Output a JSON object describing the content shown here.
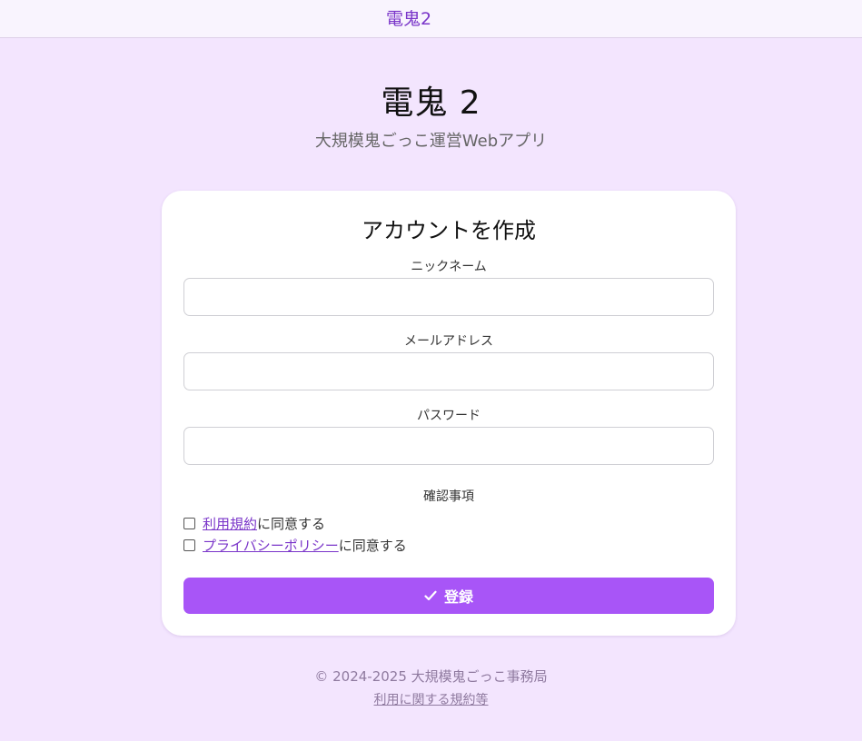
{
  "header": {
    "brand": "電鬼2"
  },
  "hero": {
    "title": "電鬼 2",
    "subtitle": "大規模鬼ごっこ運営Webアプリ"
  },
  "form": {
    "title": "アカウントを作成",
    "nickname_label": "ニックネーム",
    "nickname_value": "",
    "email_label": "メールアドレス",
    "email_value": "",
    "password_label": "パスワード",
    "password_value": "",
    "confirm_label": "確認事項",
    "terms": {
      "link": "利用規約",
      "suffix": "に同意する",
      "checked": false
    },
    "privacy": {
      "link": "プライバシーポリシー",
      "suffix": "に同意する",
      "checked": false
    },
    "submit_label": "登録",
    "submit_icon": "check-icon"
  },
  "footer": {
    "copyright": "© 2024-2025 大規模鬼ごっこ事務局",
    "terms_link": "利用に関する規約等"
  },
  "colors": {
    "background": "#f3e5fe",
    "accent": "#a855f7",
    "link": "#7a35c9"
  }
}
